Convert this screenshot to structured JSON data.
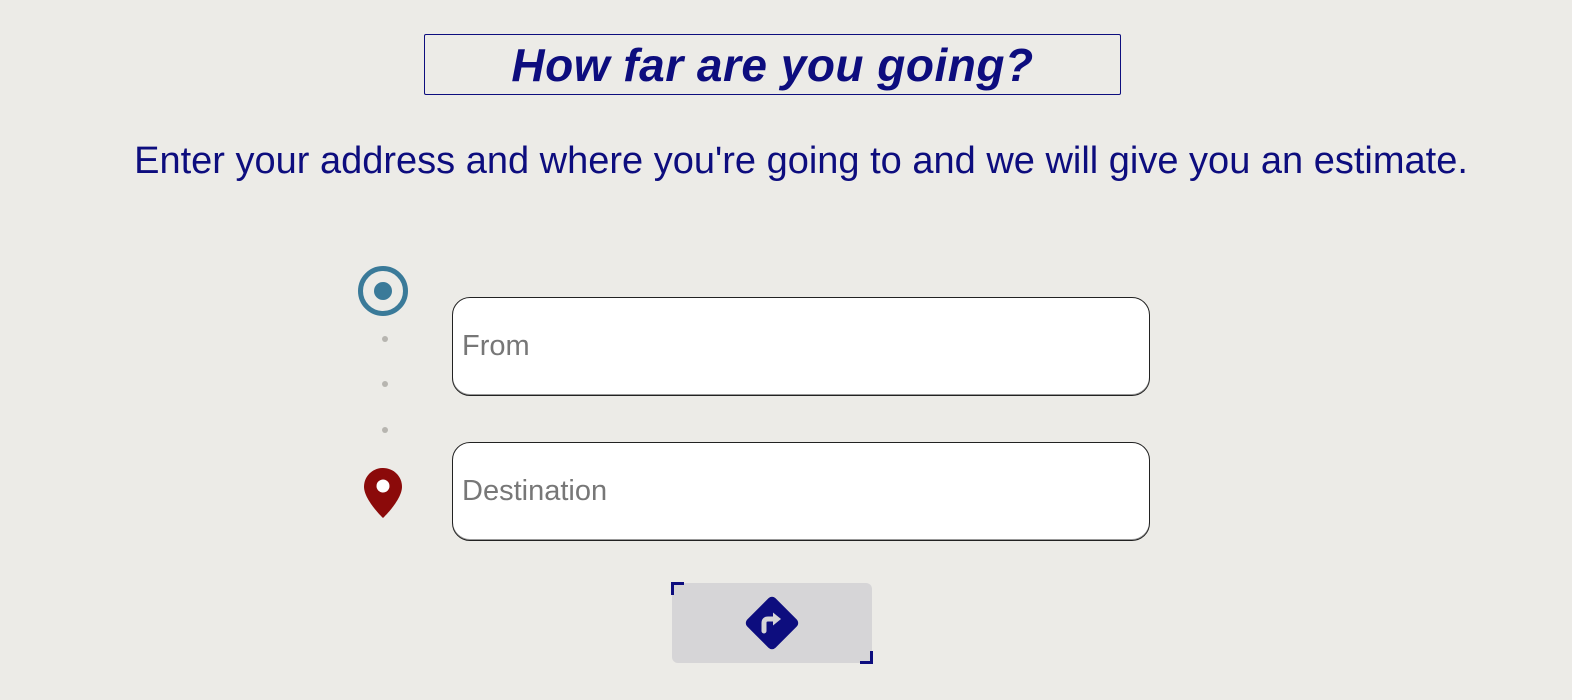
{
  "header": {
    "title": "How far are you going?"
  },
  "intro": {
    "text": "Enter your address and where you're going to and we will give you an estimate."
  },
  "form": {
    "from": {
      "placeholder": "From",
      "value": ""
    },
    "destination": {
      "placeholder": "Destination",
      "value": ""
    },
    "submit": {
      "icon": "directions-icon",
      "aria_label": "Get directions"
    }
  },
  "icons": {
    "origin": "origin-radio-icon",
    "destination": "map-pin-icon"
  },
  "colors": {
    "page_background": "#ecebe7",
    "primary_text": "#0d0d7e",
    "origin_icon": "#3a7a99",
    "destination_icon": "#8b0a0a",
    "route_dots": "#b7b5b0",
    "button_background": "#d6d5d7"
  }
}
